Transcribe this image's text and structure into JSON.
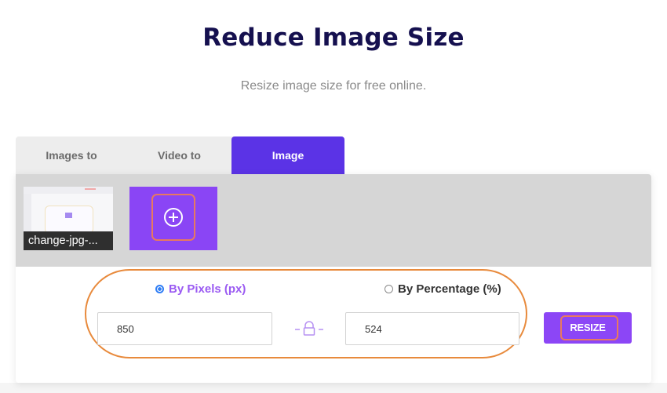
{
  "header": {
    "title": "Reduce Image Size",
    "subtitle": "Resize image size for free online."
  },
  "tabs": [
    {
      "label": "Images to GIF",
      "active": false
    },
    {
      "label": "Video to GIF",
      "active": false
    },
    {
      "label": "Image Resizer",
      "active": true
    }
  ],
  "gallery": {
    "files": [
      {
        "name": "change-jpg-..."
      }
    ],
    "add_icon": "plus-circle-icon"
  },
  "options": {
    "modes": [
      {
        "label": "By Pixels (px)",
        "selected": true
      },
      {
        "label": "By Percentage (%)",
        "selected": false
      }
    ],
    "width_value": "850",
    "height_value": "524",
    "lock_icon": "lock-icon",
    "resize_label": "RESIZE"
  },
  "colors": {
    "title": "#15104f",
    "active_tab": "#5b33e6",
    "accent_purple": "#8a45f5",
    "highlight_orange": "#e88a3c",
    "radio_blue": "#2f7ef5"
  }
}
